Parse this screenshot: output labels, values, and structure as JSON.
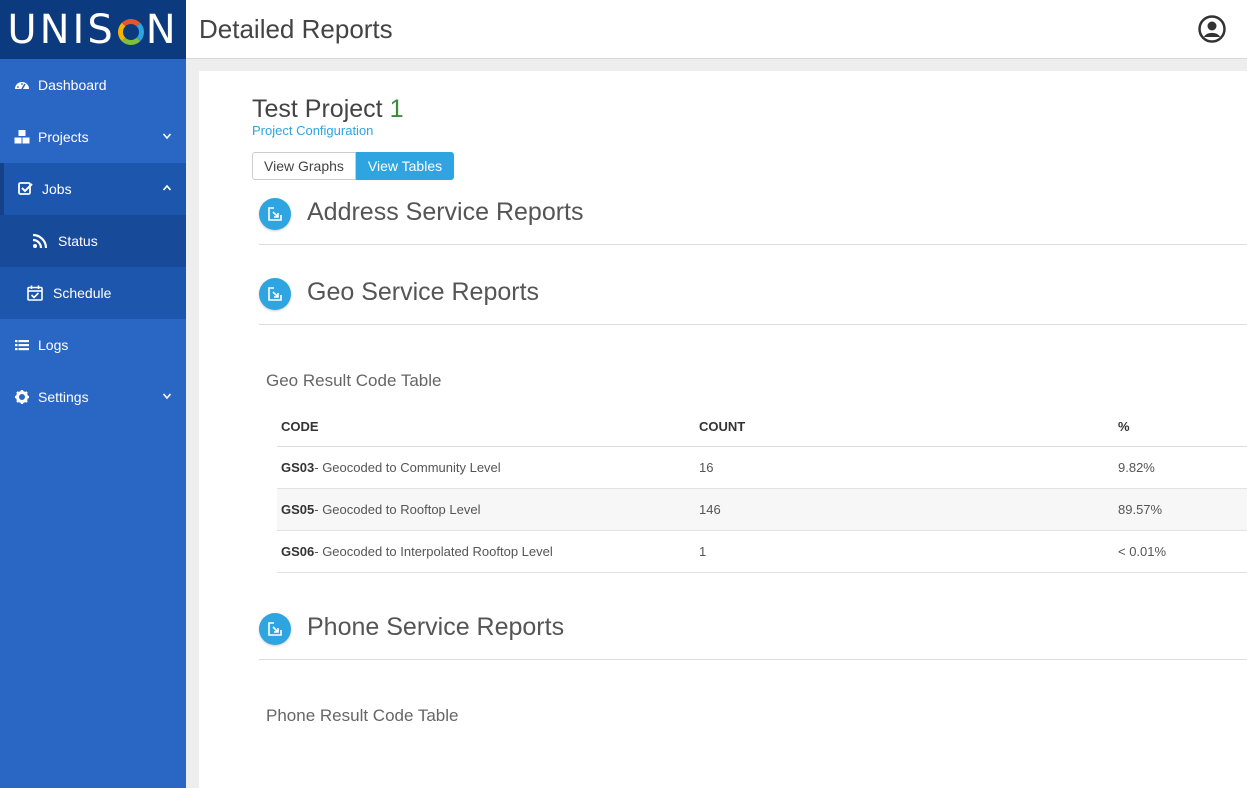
{
  "brand": {
    "logo_left": "UNIS",
    "logo_right": "N"
  },
  "header": {
    "title": "Detailed Reports"
  },
  "sidebar": {
    "items": [
      {
        "label": "Dashboard",
        "icon": "dashboard-icon"
      },
      {
        "label": "Projects",
        "icon": "projects-icon",
        "chevron": "down"
      },
      {
        "label": "Jobs",
        "icon": "checkbox-icon",
        "chevron": "up",
        "open": true
      },
      {
        "label": "Status",
        "icon": "rss-icon",
        "sub": true,
        "active": true
      },
      {
        "label": "Schedule",
        "icon": "calendar-check-icon",
        "sub": true
      },
      {
        "label": "Logs",
        "icon": "list-icon"
      },
      {
        "label": "Settings",
        "icon": "gear-icon",
        "chevron": "down"
      }
    ]
  },
  "project": {
    "title_text": "Test Project ",
    "title_number": "1",
    "config_link": "Project Configuration"
  },
  "view_toggle": {
    "graphs": "View Graphs",
    "tables": "View Tables",
    "active": "tables"
  },
  "sections": {
    "address": {
      "title": "Address Service Reports"
    },
    "geo": {
      "title": "Geo Service Reports",
      "table_title": "Geo Result Code Table"
    },
    "phone": {
      "title": "Phone Service Reports",
      "table_title": "Phone Result Code Table"
    }
  },
  "geo_table": {
    "headers": [
      "CODE",
      "COUNT",
      "%"
    ],
    "rows": [
      {
        "code": "GS03",
        "desc": "- Geocoded to Community Level",
        "count": "16",
        "pct": "9.82%"
      },
      {
        "code": "GS05",
        "desc": "- Geocoded to Rooftop Level",
        "count": "146",
        "pct": "89.57%"
      },
      {
        "code": "GS06",
        "desc": "- Geocoded to Interpolated Rooftop Level",
        "count": "1",
        "pct": "< 0.01%"
      }
    ]
  },
  "colors": {
    "sidebar": "#2a66c4",
    "logo_bg": "#0c3a7e",
    "accent": "#2ea4e0"
  }
}
